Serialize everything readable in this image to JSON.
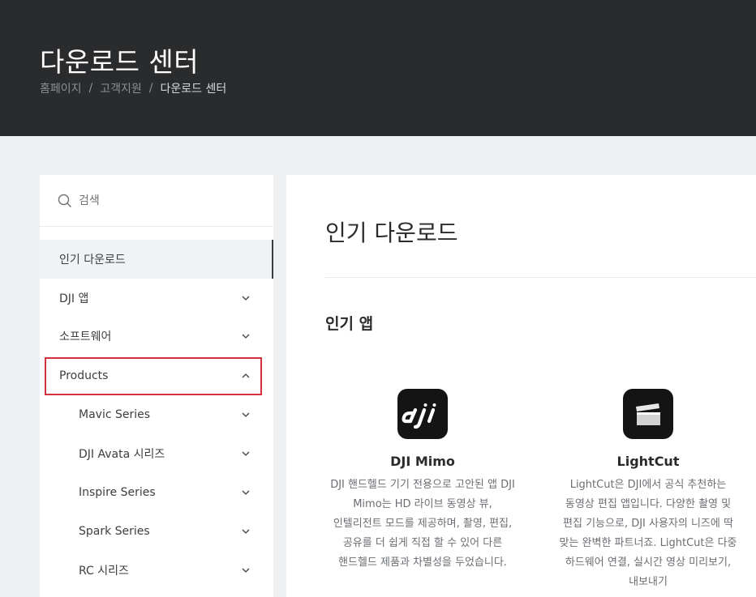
{
  "header": {
    "title": "다운로드 센터",
    "breadcrumb": [
      "홈페이지",
      "고객지원",
      "다운로드 센터"
    ],
    "separator": "/"
  },
  "sidebar": {
    "search_placeholder": "검색",
    "items": [
      {
        "label": "인기 다운로드",
        "active": true,
        "chevron": "none"
      },
      {
        "label": "DJI 앱",
        "chevron": "down"
      },
      {
        "label": "소프트웨어",
        "chevron": "down"
      },
      {
        "label": "Products",
        "chevron": "up",
        "highlighted": true
      },
      {
        "label": "Mavic Series",
        "chevron": "down",
        "sub": true
      },
      {
        "label": "DJI Avata 시리즈",
        "chevron": "down",
        "sub": true
      },
      {
        "label": "Inspire Series",
        "chevron": "down",
        "sub": true
      },
      {
        "label": "Spark Series",
        "chevron": "down",
        "sub": true
      },
      {
        "label": "RC 시리즈",
        "chevron": "down",
        "sub": true
      }
    ]
  },
  "main": {
    "title": "인기 다운로드",
    "section_title": "인기 앱",
    "apps": [
      {
        "name": "DJI Mimo",
        "icon": "dji-logo-icon",
        "description": "DJI 핸드헬드 기기 전용으로 고안된 앱 DJI Mimo는 HD 라이브 동영상 뷰, 인텔리전트 모드를 제공하며, 촬영, 편집, 공유를 더 쉽게 직접 할 수 있어 다른 핸드헬드 제품과 차별성을 두었습니다."
      },
      {
        "name": "LightCut",
        "icon": "clapperboard-icon",
        "description": "LightCut은 DJI에서 공식 추천하는 동영상 편집 앱입니다. 다양한 촬영 및 편집 기능으로, DJI 사용자의 니즈에 딱 맞는 완벽한 파트너죠. LightCut은 다중 하드웨어 연결, 실시간 영상 미리보기, 내보내기"
      }
    ]
  },
  "colors": {
    "header_bg": "#2a2b2d",
    "page_bg": "#eff0f2",
    "highlight_border": "#d4313e"
  }
}
